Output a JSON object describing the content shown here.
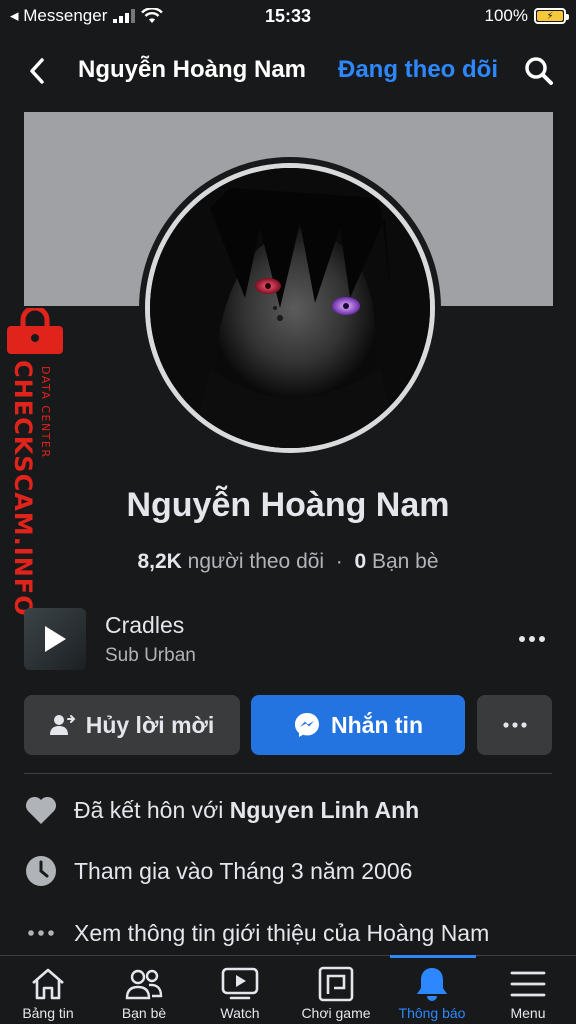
{
  "status_bar": {
    "carrier": "◂ Messenger",
    "time": "15:33",
    "battery": "100%"
  },
  "header": {
    "title": "Nguyễn Hoàng Nam",
    "follow_status": "Đang theo dõi"
  },
  "watermark": {
    "brand": "CHECKSCAM.INFO",
    "sub": "DATA CENTER"
  },
  "profile": {
    "name": "Nguyễn Hoàng Nam",
    "followers_count": "8,2K",
    "followers_label": "người theo dõi",
    "separator": "·",
    "friends_count": "0",
    "friends_label": "Bạn bè"
  },
  "music": {
    "title": "Cradles",
    "artist": "Sub Urban"
  },
  "actions": {
    "cancel_request": "Hủy lời mời",
    "message": "Nhắn tin"
  },
  "info": {
    "married_prefix": "Đã kết hôn với",
    "married_partner": "Nguyen Linh Anh",
    "joined": "Tham gia vào Tháng 3 năm 2006",
    "see_about": "Xem thông tin giới thiệu của Hoàng Nam"
  },
  "tabs": [
    {
      "label": "Bảng tin",
      "icon": "home-icon"
    },
    {
      "label": "Bạn bè",
      "icon": "friends-icon"
    },
    {
      "label": "Watch",
      "icon": "watch-icon"
    },
    {
      "label": "Chơi game",
      "icon": "gaming-icon"
    },
    {
      "label": "Thông báo",
      "icon": "bell-icon",
      "active": true
    },
    {
      "label": "Menu",
      "icon": "menu-icon"
    }
  ],
  "colors": {
    "background": "#18191a",
    "accent": "#2d88ff",
    "message_button": "#2374e1",
    "watermark": "#e0231b"
  }
}
